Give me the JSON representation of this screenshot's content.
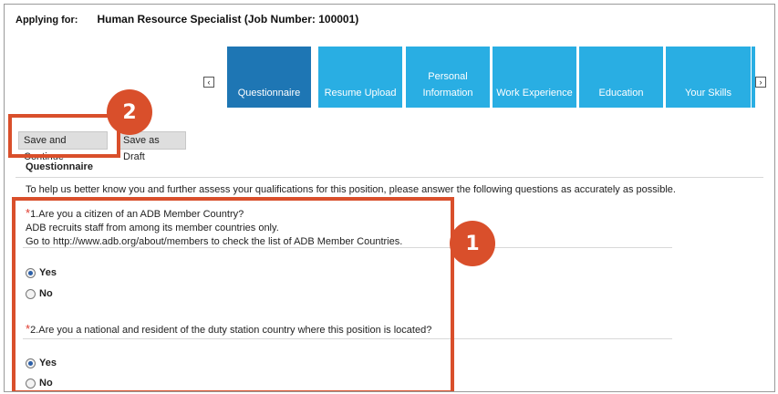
{
  "header": {
    "applying_label": "Applying for:",
    "job_title": "Human Resource Specialist (Job Number: 100001)"
  },
  "tabs": [
    {
      "label": "Questionnaire",
      "active": true
    },
    {
      "label": "Resume Upload",
      "active": false
    },
    {
      "label": "Personal Information",
      "active": false
    },
    {
      "label": "Work Experience",
      "active": false
    },
    {
      "label": "Education",
      "active": false
    },
    {
      "label": "Your Skills",
      "active": false
    }
  ],
  "tab_nav": {
    "prev_icon": "‹",
    "next_icon": "›"
  },
  "toolbar": {
    "save_continue_label": "Save and Continue",
    "save_draft_label": "Save as Draft"
  },
  "section": {
    "title": "Questionnaire",
    "intro": "To help us better know you and further assess your qualifications for this position, please answer the following questions as accurately as possible."
  },
  "questions": [
    {
      "required_mark": "*",
      "text": "1.Are you a citizen of an ADB Member Country?",
      "help_lines": [
        "ADB recruits staff from among its member countries only.",
        "Go to http://www.adb.org/about/members to check the list of ADB Member Countries."
      ],
      "options": [
        {
          "label": "Yes",
          "selected": true
        },
        {
          "label": "No",
          "selected": false
        }
      ]
    },
    {
      "required_mark": "*",
      "text": "2.Are you a national and resident of the duty station country where this position is located?",
      "options": [
        {
          "label": "Yes",
          "selected": true
        },
        {
          "label": "No",
          "selected": false
        }
      ]
    }
  ],
  "annotations": {
    "badge_1": "1",
    "badge_2": "2",
    "color": "#d94f2b"
  },
  "colors": {
    "tab_bg": "#29aee3",
    "tab_active_bg": "#1e76b4",
    "required": "#e03a2e"
  }
}
